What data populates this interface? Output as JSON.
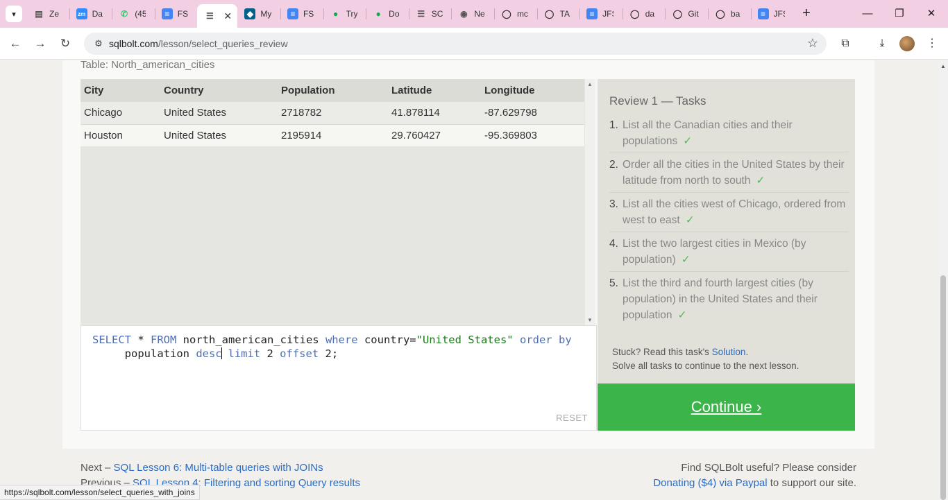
{
  "browser": {
    "tabs": [
      {
        "title": "Ze",
        "icon": "document-icon",
        "color": "#555555"
      },
      {
        "title": "Da",
        "icon": "zoom-icon",
        "color": "#2d8cff"
      },
      {
        "title": "(45",
        "icon": "whatsapp-icon",
        "color": "#25d366"
      },
      {
        "title": "FSI",
        "icon": "google-docs-icon",
        "color": "#4285f4"
      },
      {
        "title": "",
        "icon": "database-icon",
        "color": "#555555",
        "active": true
      },
      {
        "title": "My",
        "icon": "mysql-icon",
        "color": "#00618a"
      },
      {
        "title": "FSI",
        "icon": "google-docs-icon",
        "color": "#4285f4"
      },
      {
        "title": "Try",
        "icon": "mongodb-icon",
        "color": "#13aa52"
      },
      {
        "title": "Do",
        "icon": "mongodb-icon",
        "color": "#13aa52"
      },
      {
        "title": "SC",
        "icon": "database-icon",
        "color": "#555555"
      },
      {
        "title": "Ne",
        "icon": "chrome-icon",
        "color": "#555555"
      },
      {
        "title": "mc",
        "icon": "github-icon",
        "color": "#333333"
      },
      {
        "title": "TA",
        "icon": "github-icon",
        "color": "#333333"
      },
      {
        "title": "JFS",
        "icon": "google-docs-icon",
        "color": "#4285f4"
      },
      {
        "title": "da",
        "icon": "github-icon",
        "color": "#333333"
      },
      {
        "title": "Git",
        "icon": "github-icon",
        "color": "#333333"
      },
      {
        "title": "ba",
        "icon": "github-icon",
        "color": "#333333"
      },
      {
        "title": "JFS",
        "icon": "google-docs-icon",
        "color": "#4285f4"
      }
    ],
    "url_host": "sqlbolt.com",
    "url_path": "/lesson/select_queries_review",
    "status_url": "https://sqlbolt.com/lesson/select_queries_with_joins"
  },
  "lesson": {
    "table_caption": "Table: North_american_cities",
    "columns": [
      "City",
      "Country",
      "Population",
      "Latitude",
      "Longitude"
    ],
    "rows": [
      [
        "Chicago",
        "United States",
        "2718782",
        "41.878114",
        "-87.629798"
      ],
      [
        "Houston",
        "United States",
        "2195914",
        "29.760427",
        "-95.369803"
      ]
    ],
    "query_tokens": [
      {
        "t": "SELECT",
        "c": "kw"
      },
      {
        "t": " * ",
        "c": "plain"
      },
      {
        "t": "FROM",
        "c": "kw"
      },
      {
        "t": " north_american_cities ",
        "c": "plain"
      },
      {
        "t": "where",
        "c": "kw"
      },
      {
        "t": " country=",
        "c": "plain"
      },
      {
        "t": "\"United States\"",
        "c": "str"
      },
      {
        "t": " ",
        "c": "plain"
      },
      {
        "t": "order",
        "c": "kw"
      },
      {
        "t": " ",
        "c": "plain"
      },
      {
        "t": "by",
        "c": "kw"
      },
      {
        "t": "\n     population ",
        "c": "plain"
      },
      {
        "t": "desc",
        "c": "kw"
      },
      {
        "t": "|",
        "c": "caret"
      },
      {
        "t": " ",
        "c": "plain"
      },
      {
        "t": "limit",
        "c": "kw"
      },
      {
        "t": " 2 ",
        "c": "plain"
      },
      {
        "t": "offset",
        "c": "kw"
      },
      {
        "t": " 2",
        "c": "plain"
      },
      {
        "t": ";",
        "c": "plain"
      }
    ],
    "reset_label": "RESET",
    "tasks_title": "Review 1 — Tasks",
    "tasks": [
      {
        "num": "1.",
        "text": "List all the Canadian cities and their populations"
      },
      {
        "num": "2.",
        "text": "Order all the cities in the United States by their latitude from north to south"
      },
      {
        "num": "3.",
        "text": "List all the cities west of Chicago, ordered from west to east"
      },
      {
        "num": "4.",
        "text": "List the two largest cities in Mexico (by population)"
      },
      {
        "num": "5.",
        "text": "List the third and fourth largest cities (by population) in the United States and their population"
      }
    ],
    "check_mark": "✓",
    "stuck_text": "Stuck? Read this task's ",
    "solution_link": "Solution",
    "stuck_end": ".",
    "solve_all_text": "Solve all tasks to continue to the next lesson.",
    "continue_label": "Continue ›"
  },
  "footer": {
    "next_prefix": "Next – ",
    "next_link": "SQL Lesson 6: Multi-table queries with JOINs",
    "prev_prefix": "Previous – ",
    "prev_link": "SQL Lesson 4: Filtering and sorting Query results",
    "useful_text": "Find SQLBolt useful? Please consider",
    "donate_link": "Donating ($4) via Paypal",
    "donate_suffix": " to support our site."
  },
  "colors": {
    "tabstrip": "#f2cfe3",
    "continue": "#3bb54a",
    "link": "#2a6bc4",
    "check": "#5cb85c",
    "keyword": "#4f6db0",
    "string": "#1a7a1a"
  }
}
